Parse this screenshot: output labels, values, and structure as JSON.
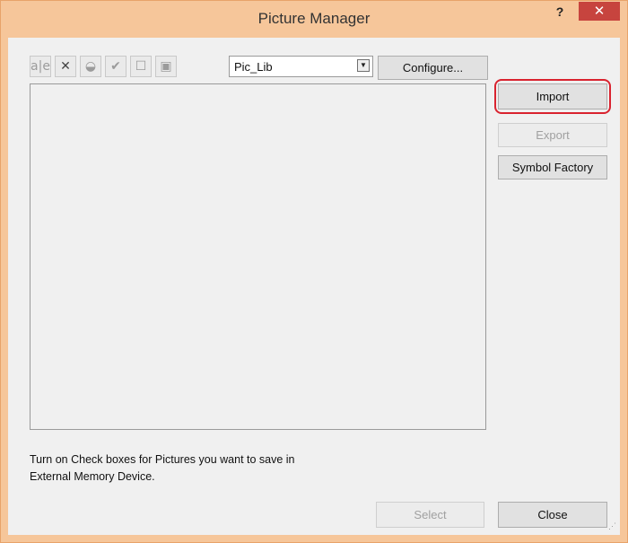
{
  "window": {
    "title": "Picture Manager",
    "help_label": "?",
    "close_label": "✕"
  },
  "toolbar": {
    "icons": [
      {
        "name": "rename-icon",
        "glyph": "a|e"
      },
      {
        "name": "delete-icon",
        "glyph": "✕"
      },
      {
        "name": "paint-icon",
        "glyph": "◒"
      },
      {
        "name": "check-icon",
        "glyph": "✔"
      },
      {
        "name": "uncheck-icon",
        "glyph": "☐"
      },
      {
        "name": "properties-icon",
        "glyph": "▣"
      }
    ],
    "library_select": "Pic_Lib",
    "configure_label": "Configure..."
  },
  "side_buttons": {
    "import_label": "Import",
    "export_label": "Export",
    "symbol_factory_label": "Symbol Factory"
  },
  "info_line1": "Turn on Check boxes for Pictures you want to save in",
  "info_line2": "External Memory Device.",
  "footer": {
    "select_label": "Select",
    "close_label": "Close"
  },
  "colors": {
    "title_bar": "#f6c69a",
    "close_button": "#c7443e",
    "highlight": "#d9232f"
  }
}
